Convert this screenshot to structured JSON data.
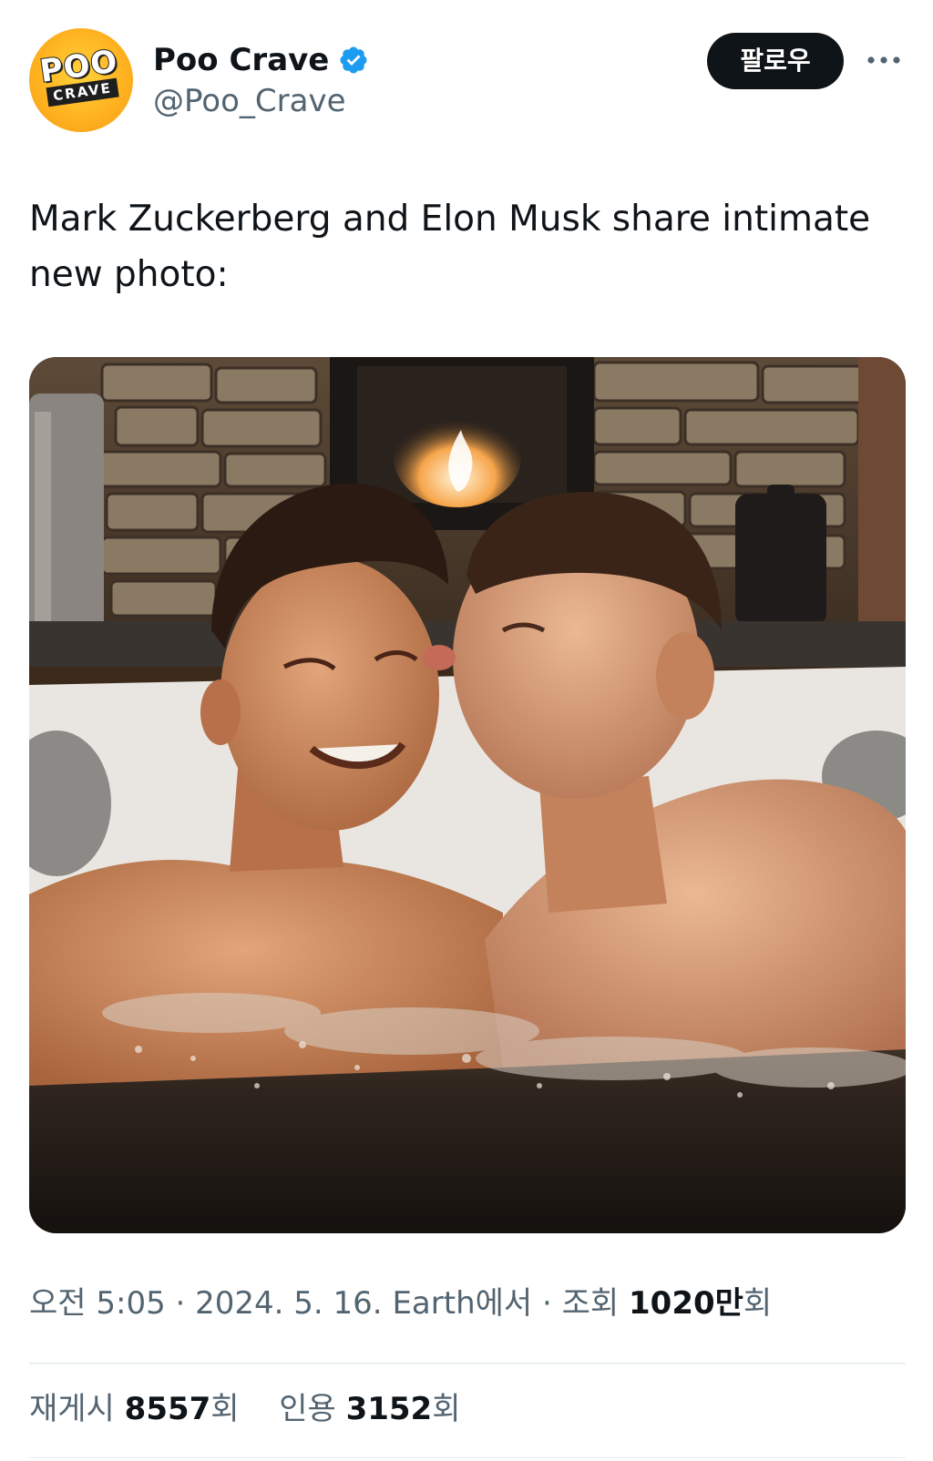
{
  "author": {
    "display_name": "Poo Crave",
    "handle": "@Poo_Crave",
    "verified": true,
    "avatar": {
      "logo_line1": "POO",
      "logo_line2": "CRAVE",
      "color": "#ffb321"
    }
  },
  "actions": {
    "follow_label": "팔로우",
    "more_icon": "more-horizontal-icon"
  },
  "tweet": {
    "text": "Mark Zuckerberg and Elon Musk share intimate new photo:"
  },
  "meta": {
    "time": "오전 5:05",
    "separator": " · ",
    "date": "2024. 5. 16.",
    "location": "Earth에서",
    "views_label": "조회",
    "views_number": "1020만",
    "views_suffix": "회"
  },
  "stats": {
    "retweets_label": "재게시",
    "retweets_count": "8557",
    "retweets_suffix": "회",
    "quotes_label": "인용",
    "quotes_count": "3152",
    "quotes_suffix": "회"
  },
  "colors": {
    "text_primary": "#0f1419",
    "text_secondary": "#536471",
    "verified": "#1d9bf0",
    "follow_bg": "#0f1419"
  }
}
